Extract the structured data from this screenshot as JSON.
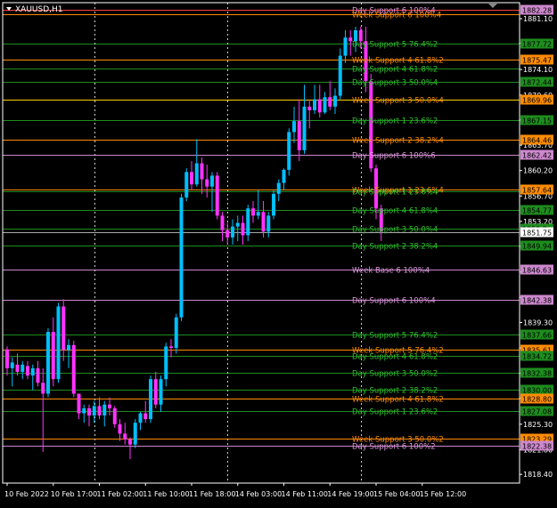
{
  "symbol_label": "XAUUSD,H1",
  "colors": {
    "background": "#000000",
    "axis": "#ffffff",
    "bull": "#00bfff",
    "bear": "#ff33ff",
    "day_line": "#1e8c1e",
    "day_text": "#2fbf2f",
    "week_line": "#ff8c00",
    "week_text": "#ff8c00",
    "day6_line": "#cc88cc",
    "day6_text": "#dd99dd",
    "yellow": "#ffd000",
    "red_line": "#ff4040",
    "price_line": "#aaaaaa"
  },
  "chart_data": {
    "type": "candlestick",
    "ylim": [
      1817.2,
      1883.3
    ],
    "y_ticks": [
      1881.1,
      1877.72,
      1874.1,
      1870.6,
      1867.15,
      1863.7,
      1860.2,
      1856.7,
      1853.2,
      1849.75,
      1846.25,
      1842.75,
      1839.3,
      1835.8,
      1832.3,
      1828.85,
      1825.3,
      1821.8,
      1818.4
    ],
    "x_labels": [
      "10 Feb 2022",
      "10 Feb 17:00",
      "11 Feb 02:00",
      "11 Feb 10:00",
      "11 Feb 18:00",
      "14 Feb 03:00",
      "14 Feb 11:00",
      "14 Feb 19:00",
      "15 Feb 04:00",
      "15 Feb 12:00"
    ],
    "x_label_bars": [
      0,
      9,
      18,
      27,
      36,
      45,
      54,
      63,
      72,
      81
    ],
    "vertical_dashed_bars": [
      17,
      43,
      69
    ],
    "candles": [
      [
        1835.6,
        1836.0,
        1832.0,
        1833.0
      ],
      [
        1833.0,
        1834.5,
        1830.5,
        1833.8
      ],
      [
        1833.5,
        1835.0,
        1832.0,
        1832.5
      ],
      [
        1832.5,
        1834.0,
        1831.5,
        1833.5
      ],
      [
        1833.3,
        1834.0,
        1831.5,
        1832.0
      ],
      [
        1832.0,
        1833.5,
        1830.0,
        1833.0
      ],
      [
        1833.0,
        1834.0,
        1830.5,
        1831.0
      ],
      [
        1831.0,
        1833.0,
        1821.5,
        1829.5
      ],
      [
        1829.5,
        1838.5,
        1829.0,
        1838.0
      ],
      [
        1838.0,
        1840.0,
        1830.5,
        1831.5
      ],
      [
        1831.5,
        1842.0,
        1831.0,
        1841.5
      ],
      [
        1841.5,
        1842.5,
        1834.0,
        1835.5
      ],
      [
        1835.5,
        1837.0,
        1833.0,
        1836.2
      ],
      [
        1836.2,
        1836.8,
        1829.0,
        1829.5
      ],
      [
        1829.5,
        1829.5,
        1826.0,
        1826.8
      ],
      [
        1826.8,
        1828.0,
        1825.5,
        1827.5
      ],
      [
        1827.5,
        1828.0,
        1825.0,
        1826.5
      ],
      [
        1826.5,
        1828.5,
        1825.5,
        1827.8
      ],
      [
        1827.8,
        1829.0,
        1826.0,
        1826.5
      ],
      [
        1826.5,
        1828.5,
        1825.0,
        1828.0
      ],
      [
        1828.0,
        1829.0,
        1826.5,
        1827.5
      ],
      [
        1827.5,
        1827.8,
        1824.8,
        1825.3
      ],
      [
        1825.3,
        1826.0,
        1823.0,
        1824.0
      ],
      [
        1824.0,
        1825.5,
        1822.5,
        1823.2
      ],
      [
        1823.2,
        1823.5,
        1820.5,
        1822.5
      ],
      [
        1822.5,
        1826.0,
        1822.0,
        1825.5
      ],
      [
        1825.5,
        1827.0,
        1824.5,
        1826.8
      ],
      [
        1826.8,
        1828.5,
        1825.5,
        1826.0
      ],
      [
        1826.0,
        1832.0,
        1825.5,
        1831.5
      ],
      [
        1831.5,
        1832.5,
        1827.5,
        1828.0
      ],
      [
        1828.0,
        1832.0,
        1827.0,
        1831.5
      ],
      [
        1831.5,
        1836.5,
        1830.5,
        1836.0
      ],
      [
        1836.0,
        1837.0,
        1834.5,
        1835.8
      ],
      [
        1835.8,
        1840.5,
        1835.0,
        1840.0
      ],
      [
        1840.0,
        1857.0,
        1839.5,
        1856.5
      ],
      [
        1856.5,
        1860.5,
        1856.0,
        1860.0
      ],
      [
        1860.0,
        1861.5,
        1857.5,
        1858.3
      ],
      [
        1858.3,
        1864.5,
        1858.0,
        1861.2
      ],
      [
        1861.2,
        1862.0,
        1857.0,
        1859.0
      ],
      [
        1859.0,
        1861.0,
        1856.5,
        1858.0
      ],
      [
        1858.0,
        1860.0,
        1854.5,
        1859.5
      ],
      [
        1859.5,
        1860.0,
        1853.5,
        1854.0
      ],
      [
        1854.0,
        1854.5,
        1850.5,
        1852.0
      ],
      [
        1852.0,
        1853.0,
        1850.0,
        1851.0
      ],
      [
        1851.0,
        1853.5,
        1850.0,
        1852.5
      ],
      [
        1852.5,
        1854.0,
        1850.5,
        1853.0
      ],
      [
        1853.0,
        1854.0,
        1850.0,
        1851.3
      ],
      [
        1851.3,
        1855.5,
        1850.5,
        1855.0
      ],
      [
        1855.0,
        1856.0,
        1853.0,
        1854.0
      ],
      [
        1854.0,
        1857.5,
        1853.5,
        1854.5
      ],
      [
        1854.5,
        1856.0,
        1851.0,
        1851.8
      ],
      [
        1851.8,
        1854.5,
        1851.0,
        1854.0
      ],
      [
        1854.0,
        1857.5,
        1853.5,
        1857.0
      ],
      [
        1857.0,
        1859.0,
        1856.0,
        1858.5
      ],
      [
        1858.5,
        1860.5,
        1857.5,
        1860.3
      ],
      [
        1860.3,
        1866.0,
        1859.5,
        1865.5
      ],
      [
        1865.5,
        1869.0,
        1864.0,
        1867.0
      ],
      [
        1867.0,
        1870.0,
        1861.5,
        1863.0
      ],
      [
        1863.0,
        1872.0,
        1862.5,
        1869.0
      ],
      [
        1869.0,
        1870.0,
        1866.0,
        1868.5
      ],
      [
        1868.5,
        1872.0,
        1868.0,
        1870.0
      ],
      [
        1870.0,
        1872.0,
        1867.5,
        1868.2
      ],
      [
        1868.2,
        1871.0,
        1868.0,
        1870.3
      ],
      [
        1870.3,
        1872.5,
        1868.5,
        1869.0
      ],
      [
        1869.0,
        1871.5,
        1868.0,
        1870.5
      ],
      [
        1870.5,
        1877.0,
        1870.0,
        1876.0
      ],
      [
        1876.0,
        1879.5,
        1875.0,
        1878.5
      ],
      [
        1878.5,
        1879.5,
        1876.0,
        1878.0
      ],
      [
        1878.0,
        1880.0,
        1876.5,
        1879.5
      ],
      [
        1879.5,
        1880.0,
        1877.0,
        1878.0
      ],
      [
        1878.0,
        1880.0,
        1871.0,
        1872.5
      ],
      [
        1872.5,
        1873.5,
        1860.0,
        1860.5
      ],
      [
        1860.5,
        1861.0,
        1853.5,
        1855.0
      ],
      [
        1855.0,
        1855.5,
        1850.5,
        1851.8
      ]
    ],
    "levels": [
      {
        "label": "Day Support 6 100%4",
        "price": 1882.28,
        "kind": "day6",
        "tag": "1882.28",
        "line": "red"
      },
      {
        "label": "Week Support 6 100%4",
        "price": 1881.7,
        "kind": "week"
      },
      {
        "label": "Day Support 5 76.4%2",
        "price": 1877.72,
        "kind": "day",
        "tag": "1877.72"
      },
      {
        "label": "Week Support 4 61.8%2",
        "price": 1875.47,
        "kind": "week",
        "tag": "1875.47"
      },
      {
        "label": "Day Support 4 61.8%2",
        "price": 1874.3,
        "kind": "day"
      },
      {
        "label": "Day Support 3 50.0%4",
        "price": 1872.44,
        "kind": "day",
        "tag": "1872.44"
      },
      {
        "label": "Week Support 3 50.0%4",
        "price": 1869.96,
        "kind": "week",
        "tag": "1869.96",
        "line": "yellow"
      },
      {
        "label": "Day Support 1 23.6%2",
        "price": 1867.15,
        "kind": "day",
        "tag": "1867.15"
      },
      {
        "label": "Week Support 2 38.2%4",
        "price": 1864.46,
        "kind": "week",
        "tag": "1864.46"
      },
      {
        "label": "Day Support 6 100%6",
        "price": 1862.42,
        "kind": "day6",
        "tag": "1862.42"
      },
      {
        "label": "Week Support 1 23.6%4",
        "price": 1857.64,
        "kind": "week",
        "tag": "1857.64"
      },
      {
        "label": "Day Support 1 23.6%4",
        "price": 1857.3,
        "kind": "day"
      },
      {
        "label": "Day Support 4 61.8%4",
        "price": 1854.77,
        "kind": "day",
        "tag": "1854.77"
      },
      {
        "label": "Day Support 3 50.0%4",
        "price": 1852.2,
        "kind": "day",
        "tag": "1852.2"
      },
      {
        "label": "Day Support 2 38.2%4",
        "price": 1849.94,
        "kind": "day",
        "tag": "1849.94"
      },
      {
        "label": "Week Base 6 100%4",
        "price": 1846.63,
        "kind": "day6",
        "tag": "1846.63"
      },
      {
        "label": "Day Support 6 100%4",
        "price": 1842.38,
        "kind": "day6",
        "tag": "1842.38"
      },
      {
        "label": "Day Support 5 76.4%2",
        "price": 1837.66,
        "kind": "day",
        "tag": "1837.66"
      },
      {
        "label": "Week Support 5 76.4%2",
        "price": 1835.61,
        "kind": "week",
        "tag": "1835.61"
      },
      {
        "label": "Day Support 4 61.8%2",
        "price": 1834.72,
        "kind": "day",
        "tag": "1834.72"
      },
      {
        "label": "Day Support 3 50.0%2",
        "price": 1832.38,
        "kind": "day",
        "tag": "1832.38"
      },
      {
        "label": "Day Support 2 38.2%2",
        "price": 1830.0,
        "kind": "day",
        "tag": "1830.00"
      },
      {
        "label": "Week Support 4 61.8%2",
        "price": 1828.8,
        "kind": "week",
        "tag": "1828.80"
      },
      {
        "label": "Day Support 1 23.6%2",
        "price": 1827.08,
        "kind": "day",
        "tag": "1827.08"
      },
      {
        "label": "Week Support 3 50.0%2",
        "price": 1823.29,
        "kind": "week",
        "tag": "1823.29"
      },
      {
        "label": "Day Support 6 100%2",
        "price": 1822.38,
        "kind": "day6",
        "tag": "1822.38"
      }
    ],
    "current_price": {
      "value": 1851.75,
      "tag": "1851.75"
    }
  }
}
